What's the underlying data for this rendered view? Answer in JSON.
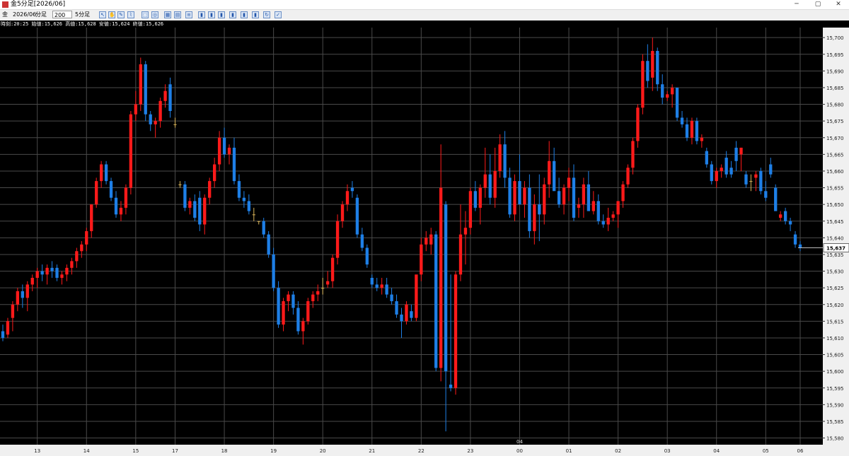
{
  "window": {
    "title": "金5分足[2026/06]",
    "minimize": "─",
    "maximize": "▢",
    "close": "✕"
  },
  "toolbar": {
    "symbol": "金",
    "contract": "2026/06",
    "unit_select": "分足",
    "count_value": "200",
    "period_select": "5分足",
    "icons": [
      "cursor-icon",
      "hand-icon",
      "pencil-icon",
      "ruler-icon",
      "select-icon",
      "circle-icon",
      "grid-icon",
      "table-icon",
      "list-icon",
      "bar-chart-icon",
      "bar-chart-2-icon",
      "bar-chart-3-icon",
      "bar-chart-4-icon",
      "bar-chart-5-icon",
      "bar-chart-6-icon",
      "refresh-icon",
      "pin-icon"
    ]
  },
  "info": "時刻:20:25 始値:15,626 高値:15,628 安値:15,624 終値:15,626",
  "colors": {
    "background": "#000000",
    "grid": "#4a4a4a",
    "up": "#ff1a1a",
    "down": "#1e7fe6",
    "doji": "#d8b45a",
    "axis_bg": "#f0f0f0"
  },
  "chart_data": {
    "type": "candlestick",
    "ylim": [
      15578,
      15703
    ],
    "y_ticks": [
      "15,580",
      "15,585",
      "15,590",
      "15,595",
      "15,600",
      "15,605",
      "15,610",
      "15,615",
      "15,620",
      "15,625",
      "15,630",
      "15,635",
      "15,640",
      "15,645",
      "15,650",
      "15,655",
      "15,660",
      "15,665",
      "15,670",
      "15,675",
      "15,680",
      "15,685",
      "15,690",
      "15,695",
      "15,700"
    ],
    "x_labels": [
      {
        "label": "13",
        "bar": 7
      },
      {
        "label": "14",
        "bar": 17
      },
      {
        "label": "15",
        "bar": 27
      },
      {
        "label": "17",
        "bar": 35
      },
      {
        "label": "18",
        "bar": 45
      },
      {
        "label": "19",
        "bar": 55
      },
      {
        "label": "20",
        "bar": 65
      },
      {
        "label": "21",
        "bar": 75
      },
      {
        "label": "22",
        "bar": 85
      },
      {
        "label": "23",
        "bar": 95
      },
      {
        "label": "00",
        "bar": 105
      },
      {
        "label": "01",
        "bar": 115
      },
      {
        "label": "02",
        "bar": 125
      },
      {
        "label": "03",
        "bar": 135
      },
      {
        "label": "04",
        "bar": 145
      },
      {
        "label": "05",
        "bar": 155
      },
      {
        "label": "06",
        "bar": 162
      }
    ],
    "x_top_label": {
      "label": "04",
      "bar": 105
    },
    "last_price": "15,637",
    "ohlc": [
      [
        15612,
        15614,
        15609,
        15610
      ],
      [
        15611,
        15616,
        15610,
        15615
      ],
      [
        15616,
        15621,
        15612,
        15620
      ],
      [
        15620,
        15625,
        15618,
        15624
      ],
      [
        15624,
        15626,
        15619,
        15622
      ],
      [
        15622,
        15627,
        15618,
        15626
      ],
      [
        15626,
        15629,
        15624,
        15628
      ],
      [
        15628,
        15631,
        15625,
        15630
      ],
      [
        15630,
        15632,
        15627,
        15629
      ],
      [
        15629,
        15632,
        15626,
        15631
      ],
      [
        15631,
        15633,
        15628,
        15630
      ],
      [
        15631,
        15632,
        15627,
        15628
      ],
      [
        15628,
        15630,
        15626,
        15629
      ],
      [
        15629,
        15632,
        15627,
        15631
      ],
      [
        15631,
        15634,
        15629,
        15633
      ],
      [
        15633,
        15637,
        15631,
        15636
      ],
      [
        15636,
        15639,
        15634,
        15638
      ],
      [
        15638,
        15643,
        15636,
        15642
      ],
      [
        15642,
        15648,
        15640,
        15650
      ],
      [
        15650,
        15658,
        15649,
        15657
      ],
      [
        15657,
        15663,
        15655,
        15662
      ],
      [
        15662,
        15663,
        15656,
        15657
      ],
      [
        15657,
        15658,
        15651,
        15652
      ],
      [
        15652,
        15654,
        15646,
        15647
      ],
      [
        15647,
        15651,
        15645,
        15649
      ],
      [
        15649,
        15656,
        15647,
        15655
      ],
      [
        15655,
        15678,
        15653,
        15677
      ],
      [
        15677,
        15684,
        15675,
        15680
      ],
      [
        15680,
        15694,
        15678,
        15692
      ],
      [
        15692,
        15693,
        15675,
        15677
      ],
      [
        15677,
        15678,
        15672,
        15674
      ],
      [
        15674,
        15676,
        15670,
        15675
      ],
      [
        15675,
        15682,
        15673,
        15681
      ],
      [
        15681,
        15686,
        15679,
        15684
      ],
      [
        15686,
        15688,
        15676,
        15678
      ],
      [
        15674,
        15676,
        15673,
        15674
      ],
      [
        15656,
        15657,
        15655,
        15656
      ],
      [
        15656,
        15657,
        15648,
        15649
      ],
      [
        15649,
        15652,
        15647,
        15651
      ],
      [
        15651,
        15653,
        15645,
        15646
      ],
      [
        15652,
        15654,
        15642,
        15644
      ],
      [
        15644,
        15653,
        15641,
        15652
      ],
      [
        15652,
        15658,
        15650,
        15657
      ],
      [
        15657,
        15664,
        15655,
        15662
      ],
      [
        15662,
        15672,
        15660,
        15670
      ],
      [
        15670,
        15673,
        15664,
        15665
      ],
      [
        15665,
        15668,
        15662,
        15667
      ],
      [
        15667,
        15670,
        15656,
        15657
      ],
      [
        15657,
        15659,
        15651,
        15652
      ],
      [
        15652,
        15654,
        15649,
        15651
      ],
      [
        15651,
        15653,
        15647,
        15648
      ],
      [
        15647,
        15649,
        15645,
        15647
      ],
      [
        15645,
        15645,
        15644,
        15645
      ],
      [
        15645,
        15646,
        15640,
        15641
      ],
      [
        15641,
        15642,
        15634,
        15635
      ],
      [
        15635,
        15637,
        15624,
        15625
      ],
      [
        15625,
        15627,
        15613,
        15614
      ],
      [
        15614,
        15622,
        15612,
        15621
      ],
      [
        15621,
        15624,
        15618,
        15623
      ],
      [
        15623,
        15624,
        15617,
        15619
      ],
      [
        15619,
        15621,
        15611,
        15612
      ],
      [
        15612,
        15616,
        15608,
        15615
      ],
      [
        15615,
        15622,
        15614,
        15621
      ],
      [
        15621,
        15624,
        15619,
        15623
      ],
      [
        15623,
        15626,
        15621,
        15624
      ],
      [
        15625,
        15628,
        15623,
        15625
      ],
      [
        15626,
        15630,
        15625,
        15627
      ],
      [
        15627,
        15635,
        15625,
        15634
      ],
      [
        15634,
        15647,
        15632,
        15645
      ],
      [
        15645,
        15651,
        15643,
        15650
      ],
      [
        15650,
        15656,
        15648,
        15654
      ],
      [
        15655,
        15657,
        15652,
        15654
      ],
      [
        15652,
        15653,
        15640,
        15641
      ],
      [
        15641,
        15643,
        15636,
        15637
      ],
      [
        15637,
        15638,
        15631,
        15632
      ],
      [
        15628,
        15629,
        15625,
        15626
      ],
      [
        15626,
        15628,
        15624,
        15625
      ],
      [
        15625,
        15628,
        15623,
        15626
      ],
      [
        15626,
        15628,
        15622,
        15623
      ],
      [
        15623,
        15625,
        15620,
        15621
      ],
      [
        15621,
        15623,
        15616,
        15617
      ],
      [
        15617,
        15619,
        15610,
        15615
      ],
      [
        15615,
        15621,
        15614,
        15620
      ],
      [
        15618,
        15620,
        15615,
        15616
      ],
      [
        15616,
        15626,
        15615,
        15629
      ],
      [
        15629,
        15640,
        15627,
        15638
      ],
      [
        15638,
        15642,
        15636,
        15640
      ],
      [
        15638,
        15643,
        15635,
        15641
      ],
      [
        15641,
        15642,
        15600,
        15601
      ],
      [
        15601,
        15668,
        15597,
        15655
      ],
      [
        15650,
        15651,
        15582,
        15600
      ],
      [
        15596,
        15629,
        15594,
        15595
      ],
      [
        15595,
        15630,
        15593,
        15629
      ],
      [
        15629,
        15650,
        15627,
        15641
      ],
      [
        15641,
        15648,
        15632,
        15643
      ],
      [
        15643,
        15655,
        15641,
        15654
      ],
      [
        15654,
        15657,
        15648,
        15649
      ],
      [
        15649,
        15656,
        15644,
        15655
      ],
      [
        15655,
        15667,
        15652,
        15659
      ],
      [
        15659,
        15665,
        15650,
        15652
      ],
      [
        15652,
        15667,
        15649,
        15660
      ],
      [
        15660,
        15671,
        15658,
        15668
      ],
      [
        15668,
        15672,
        15655,
        15658
      ],
      [
        15658,
        15661,
        15646,
        15647
      ],
      [
        15647,
        15659,
        15645,
        15657
      ],
      [
        15657,
        15665,
        15650,
        15650
      ],
      [
        15650,
        15657,
        15646,
        15655
      ],
      [
        15655,
        15659,
        15640,
        15642
      ],
      [
        15642,
        15653,
        15638,
        15650
      ],
      [
        15650,
        15659,
        15639,
        15647
      ],
      [
        15647,
        15658,
        15644,
        15656
      ],
      [
        15656,
        15669,
        15652,
        15663
      ],
      [
        15663,
        15667,
        15657,
        15654
      ],
      [
        15654,
        15658,
        15649,
        15650
      ],
      [
        15650,
        15656,
        15647,
        15655
      ],
      [
        15655,
        15661,
        15651,
        15658
      ],
      [
        15658,
        15662,
        15645,
        15646
      ],
      [
        15649,
        15652,
        15646,
        15650
      ],
      [
        15650,
        15658,
        15646,
        15656
      ],
      [
        15656,
        15660,
        15650,
        15648
      ],
      [
        15648,
        15654,
        15647,
        15651
      ],
      [
        15651,
        15653,
        15644,
        15645
      ],
      [
        15645,
        15647,
        15643,
        15644
      ],
      [
        15644,
        15649,
        15642,
        15646
      ],
      [
        15646,
        15648,
        15645,
        15647
      ],
      [
        15647,
        15650,
        15643,
        15651
      ],
      [
        15651,
        15657,
        15649,
        15656
      ],
      [
        15656,
        15662,
        15655,
        15661
      ],
      [
        15661,
        15670,
        15659,
        15669
      ],
      [
        15669,
        15680,
        15667,
        15679
      ],
      [
        15679,
        15695,
        15677,
        15693
      ],
      [
        15693,
        15698,
        15685,
        15687
      ],
      [
        15688,
        15700,
        15684,
        15696
      ],
      [
        15696,
        15697,
        15684,
        15686
      ],
      [
        15686,
        15689,
        15680,
        15682
      ],
      [
        15682,
        15684,
        15681,
        15683
      ],
      [
        15683,
        15686,
        15679,
        15685
      ],
      [
        15685,
        15684,
        15675,
        15676
      ],
      [
        15676,
        15678,
        15673,
        15674
      ],
      [
        15674,
        15676,
        15669,
        15670
      ],
      [
        15670,
        15676,
        15668,
        15675
      ],
      [
        15675,
        15676,
        15668,
        15669
      ],
      [
        15669,
        15671,
        15667,
        15670
      ],
      [
        15666,
        15667,
        15661,
        15662
      ],
      [
        15662,
        15663,
        15656,
        15657
      ],
      [
        15657,
        15661,
        15655,
        15660
      ],
      [
        15660,
        15662,
        15658,
        15661
      ],
      [
        15664,
        15666,
        15658,
        15659
      ],
      [
        15661,
        15663,
        15658,
        15659
      ],
      [
        15667,
        15669,
        15660,
        15663
      ],
      [
        15665,
        15667,
        15660,
        15667
      ],
      [
        15659,
        15660,
        15655,
        15656
      ],
      [
        15657,
        15659,
        15654,
        15657
      ],
      [
        15658,
        15660,
        15654,
        15659
      ],
      [
        15660,
        15661,
        15653,
        15654
      ],
      [
        15654,
        15657,
        15651,
        15652
      ],
      [
        15662,
        15664,
        15658,
        15659
      ],
      [
        15655,
        15656,
        15651,
        15648
      ],
      [
        15646,
        15648,
        15645,
        15647
      ],
      [
        15648,
        15649,
        15644,
        15645
      ],
      [
        15645,
        15646,
        15642,
        15644
      ],
      [
        15641,
        15642,
        15637,
        15638
      ],
      [
        15638,
        15639,
        15636,
        15637
      ]
    ]
  }
}
